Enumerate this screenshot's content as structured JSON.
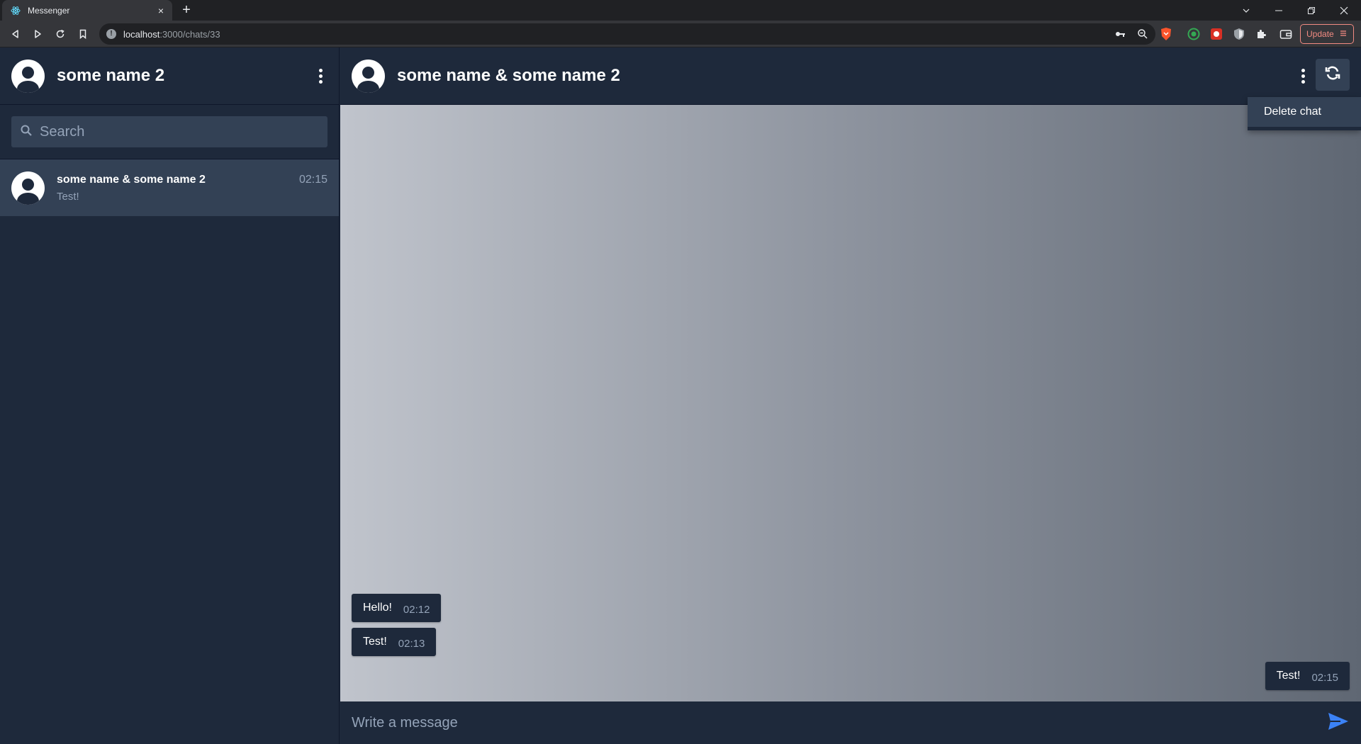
{
  "browser": {
    "tab_title": "Messenger",
    "tab_close": "×",
    "new_tab": "+",
    "url_host": "localhost",
    "url_path": ":3000/chats/33",
    "update_label": "Update"
  },
  "sidebar": {
    "user_name": "some name 2",
    "search_placeholder": "Search",
    "chats": [
      {
        "title": "some name & some name 2",
        "time": "02:15",
        "preview": "Test!"
      }
    ]
  },
  "chat": {
    "title": "some name & some name 2",
    "menu": {
      "delete_label": "Delete chat"
    },
    "messages": [
      {
        "text": "Hello!",
        "time": "02:12",
        "side": "incoming"
      },
      {
        "text": "Test!",
        "time": "02:13",
        "side": "incoming"
      },
      {
        "text": "Test!",
        "time": "02:15",
        "side": "outgoing"
      }
    ],
    "composer_placeholder": "Write a message"
  },
  "colors": {
    "panel": "#1e293b",
    "panel_light": "#334155",
    "muted_text": "#94a3b8",
    "send_accent": "#3b82f6",
    "update_accent": "#f28b82"
  }
}
